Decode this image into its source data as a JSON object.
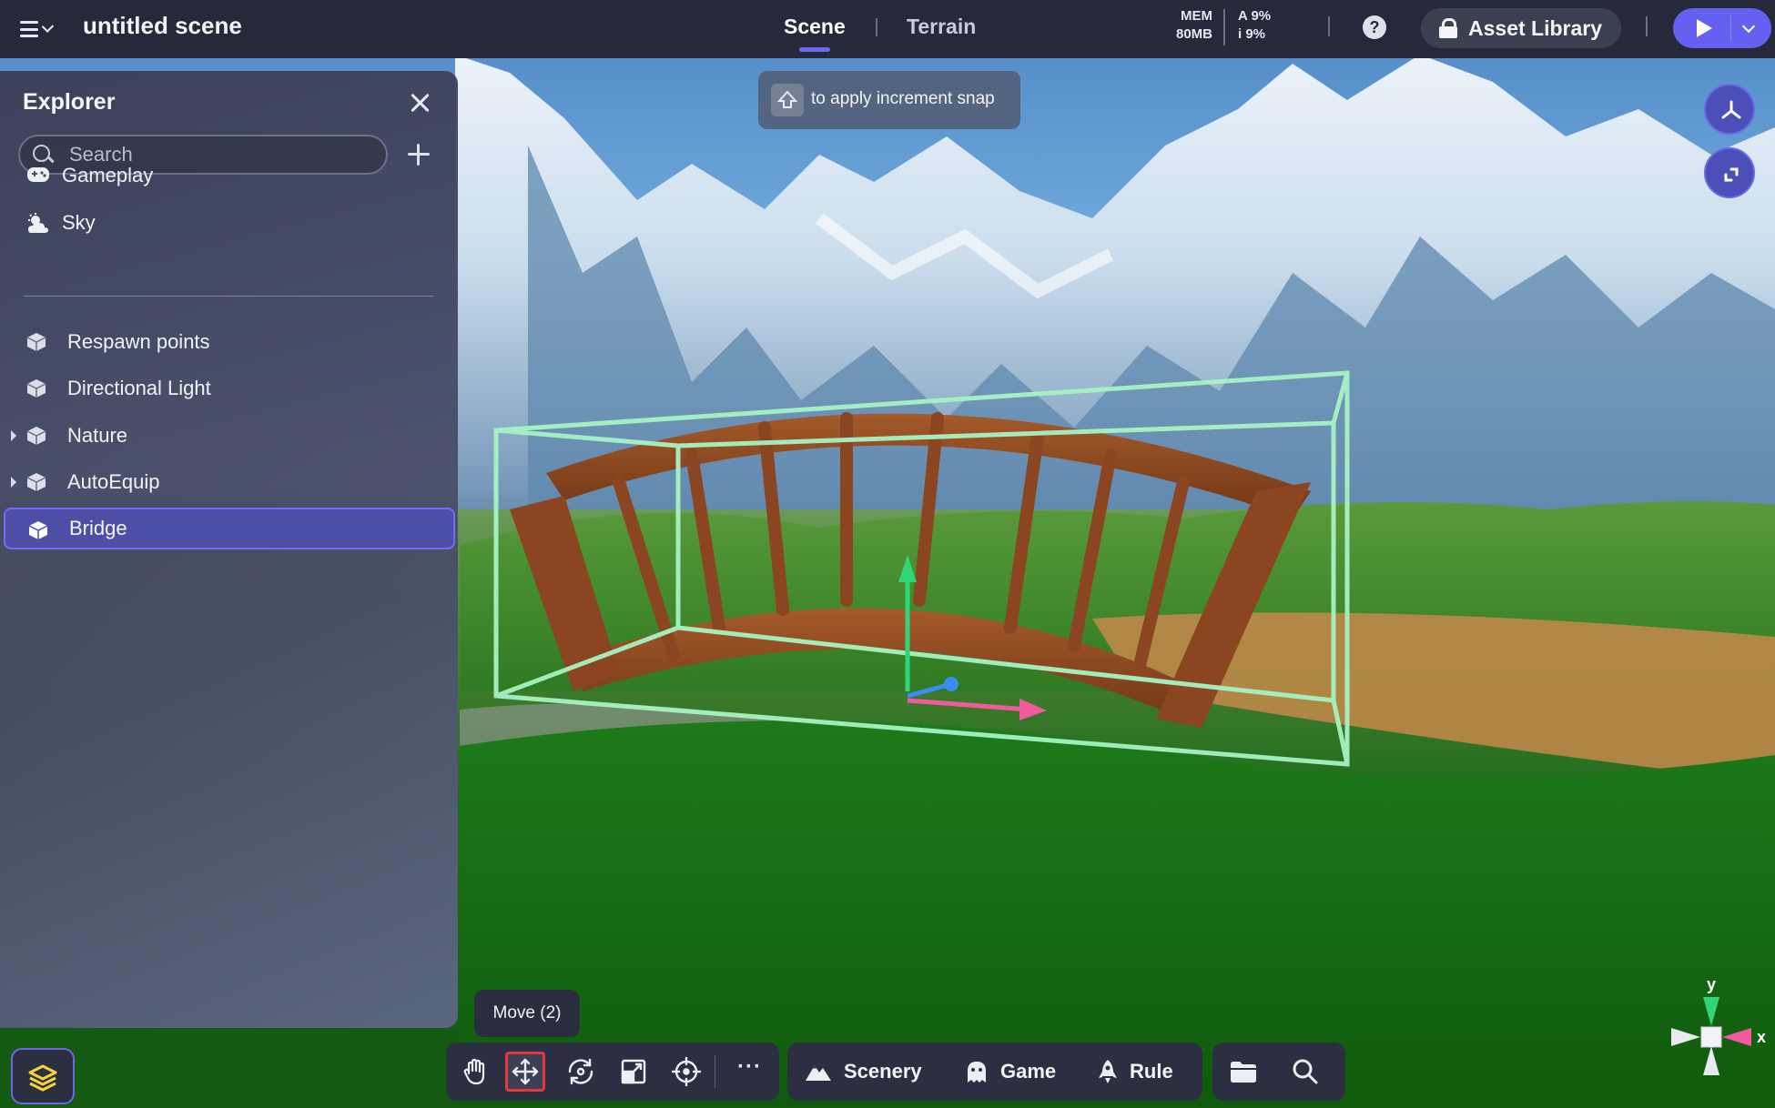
{
  "topbar": {
    "scene_title": "untitled scene",
    "tabs": [
      {
        "label": "Scene",
        "active": true
      },
      {
        "label": "Terrain",
        "active": false
      }
    ],
    "mem_label": "MEM",
    "mem_value": "80MB",
    "cpu_a": "A 9%",
    "cpu_i": "i  9%",
    "help_label": "?",
    "asset_library_label": "Asset Library",
    "accent_color": "#6560f0"
  },
  "explorer": {
    "title": "Explorer",
    "search_placeholder": "Search",
    "top_items": [
      {
        "label": "Gameplay",
        "icon": "gamepad-icon"
      },
      {
        "label": "Sky",
        "icon": "weather-icon"
      }
    ],
    "objects": [
      {
        "label": "Respawn points",
        "expandable": false,
        "selected": false
      },
      {
        "label": "Directional Light",
        "expandable": false,
        "selected": false
      },
      {
        "label": "Nature",
        "expandable": true,
        "selected": false
      },
      {
        "label": "AutoEquip",
        "expandable": true,
        "selected": false
      },
      {
        "label": "Bridge",
        "expandable": false,
        "selected": true
      }
    ]
  },
  "hint": {
    "text": "to apply increment snap",
    "key_icon": "shift-key-icon"
  },
  "tooltip": {
    "text": "Move (2)"
  },
  "toolbar": {
    "tools": [
      {
        "name": "hand-tool",
        "icon": "hand-icon",
        "active": false
      },
      {
        "name": "move-tool",
        "icon": "move-arrows-icon",
        "active": true
      },
      {
        "name": "rotate-tool",
        "icon": "rotate-icon",
        "active": false
      },
      {
        "name": "scale-tool",
        "icon": "scale-icon",
        "active": false
      },
      {
        "name": "pivot-tool",
        "icon": "pivot-icon",
        "active": false
      }
    ],
    "more_label": "···",
    "modes": [
      {
        "label": "Scenery",
        "icon": "mountain-icon"
      },
      {
        "label": "Game",
        "icon": "ghost-icon"
      },
      {
        "label": "Rule",
        "icon": "rocket-icon"
      }
    ]
  },
  "gizmo": {
    "y_label": "y",
    "x_label": "x"
  }
}
